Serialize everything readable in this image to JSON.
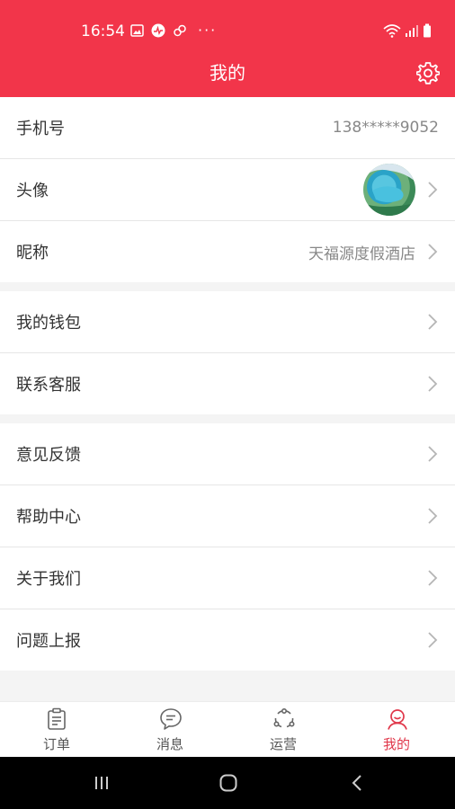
{
  "status_bar": {
    "time": "16:54",
    "overflow": "···"
  },
  "header": {
    "title": "我的",
    "settings_icon": "gear-icon",
    "bg_color": "#f2354a"
  },
  "profile": {
    "phone_label": "手机号",
    "phone_value": "138*****9052",
    "avatar_label": "头像",
    "nickname_label": "昵称",
    "nickname_value": "天福源度假酒店"
  },
  "menu_group_1": [
    {
      "label": "我的钱包"
    },
    {
      "label": "联系客服"
    }
  ],
  "menu_group_2": [
    {
      "label": "意见反馈"
    },
    {
      "label": "帮助中心"
    },
    {
      "label": "关于我们"
    },
    {
      "label": "问题上报"
    }
  ],
  "tabbar": {
    "items": [
      {
        "label": "订单",
        "icon": "clipboard-icon"
      },
      {
        "label": "消息",
        "icon": "chat-bubble-icon"
      },
      {
        "label": "运营",
        "icon": "cycle-icon"
      },
      {
        "label": "我的",
        "icon": "user-icon"
      }
    ],
    "active_index": 3,
    "active_color": "#e0374a"
  }
}
